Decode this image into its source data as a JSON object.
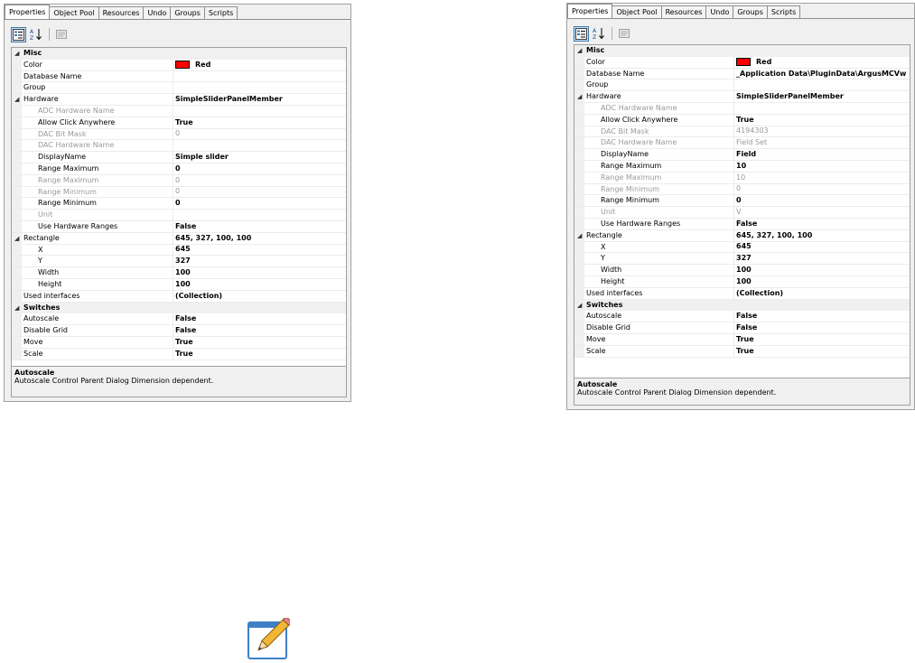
{
  "panels": [
    {
      "tabs": [
        "Properties",
        "Object Pool",
        "Resources",
        "Undo",
        "Groups",
        "Scripts"
      ],
      "rows": [
        {
          "type": "cat",
          "name": "Misc"
        },
        {
          "type": "prop",
          "name": "Color",
          "value": "Red",
          "swatch": true
        },
        {
          "type": "prop",
          "name": "Database Name",
          "value": ""
        },
        {
          "type": "prop",
          "name": "Group",
          "value": ""
        },
        {
          "type": "group",
          "name": "Hardware",
          "value": "SimpleSliderPanelMember",
          "style": "bold"
        },
        {
          "type": "sub",
          "name": "ADC Hardware Name",
          "value": "",
          "style": "gray"
        },
        {
          "type": "sub",
          "name": "Allow Click Anywhere",
          "value": "True",
          "style": "bold"
        },
        {
          "type": "sub",
          "name": "DAC Bit Mask",
          "value": "0",
          "style": "gray"
        },
        {
          "type": "sub",
          "name": "DAC Hardware Name",
          "value": "",
          "style": "gray"
        },
        {
          "type": "sub",
          "name": "DisplayName",
          "value": "Simple slider",
          "style": "bold"
        },
        {
          "type": "sub",
          "name": "Range Maximum",
          "value": "0",
          "style": "bold"
        },
        {
          "type": "sub",
          "name": "Range Maximum",
          "value": "0",
          "style": "gray"
        },
        {
          "type": "sub",
          "name": "Range Minimum",
          "value": "0",
          "style": "gray"
        },
        {
          "type": "sub",
          "name": "Range Minimum",
          "value": "0",
          "style": "bold"
        },
        {
          "type": "sub",
          "name": "Unit",
          "value": "",
          "style": "gray"
        },
        {
          "type": "sub",
          "name": "Use Hardware Ranges",
          "value": "False",
          "style": "bold"
        },
        {
          "type": "group",
          "name": "Rectangle",
          "value": "645, 327, 100, 100",
          "style": "bold"
        },
        {
          "type": "sub",
          "name": "X",
          "value": "645",
          "style": "bold"
        },
        {
          "type": "sub",
          "name": "Y",
          "value": "327",
          "style": "bold"
        },
        {
          "type": "sub",
          "name": "Width",
          "value": "100",
          "style": "bold"
        },
        {
          "type": "sub",
          "name": "Height",
          "value": "100",
          "style": "bold"
        },
        {
          "type": "prop",
          "name": "Used interfaces",
          "value": "(Collection)",
          "style": "bold"
        },
        {
          "type": "cat",
          "name": "Switches"
        },
        {
          "type": "prop",
          "name": "Autoscale",
          "value": "False",
          "style": "bold"
        },
        {
          "type": "prop",
          "name": "Disable Grid",
          "value": "False",
          "style": "bold"
        },
        {
          "type": "prop",
          "name": "Move",
          "value": "True",
          "style": "bold"
        },
        {
          "type": "prop",
          "name": "Scale",
          "value": "True",
          "style": "bold"
        }
      ],
      "help_title": "Autoscale",
      "help_text": "Autoscale Control Parent Dialog Dimension dependent."
    },
    {
      "tabs": [
        "Properties",
        "Object Pool",
        "Resources",
        "Undo",
        "Groups",
        "Scripts"
      ],
      "rows": [
        {
          "type": "cat",
          "name": "Misc"
        },
        {
          "type": "prop",
          "name": "Color",
          "value": "Red",
          "swatch": true
        },
        {
          "type": "prop",
          "name": "Database Name",
          "value": "_Application Data\\PluginData\\ArgusMCVw",
          "style": "bold"
        },
        {
          "type": "prop",
          "name": "Group",
          "value": ""
        },
        {
          "type": "group",
          "name": "Hardware",
          "value": "SimpleSliderPanelMember",
          "style": "bold"
        },
        {
          "type": "sub",
          "name": "ADC Hardware Name",
          "value": "",
          "style": "gray"
        },
        {
          "type": "sub",
          "name": "Allow Click Anywhere",
          "value": "True",
          "style": "bold"
        },
        {
          "type": "sub",
          "name": "DAC Bit Mask",
          "value": "4194303",
          "style": "gray"
        },
        {
          "type": "sub",
          "name": "DAC Hardware Name",
          "value": "Field Set",
          "style": "gray"
        },
        {
          "type": "sub",
          "name": "DisplayName",
          "value": "Field",
          "style": "bold"
        },
        {
          "type": "sub",
          "name": "Range Maximum",
          "value": "10",
          "style": "bold"
        },
        {
          "type": "sub",
          "name": "Range Maximum",
          "value": "10",
          "style": "gray"
        },
        {
          "type": "sub",
          "name": "Range Minimum",
          "value": "0",
          "style": "gray"
        },
        {
          "type": "sub",
          "name": "Range Minimum",
          "value": "0",
          "style": "bold"
        },
        {
          "type": "sub",
          "name": "Unit",
          "value": "V",
          "style": "gray"
        },
        {
          "type": "sub",
          "name": "Use Hardware Ranges",
          "value": "False",
          "style": "bold"
        },
        {
          "type": "group",
          "name": "Rectangle",
          "value": "645, 327, 100, 100",
          "style": "bold"
        },
        {
          "type": "sub",
          "name": "X",
          "value": "645",
          "style": "bold"
        },
        {
          "type": "sub",
          "name": "Y",
          "value": "327",
          "style": "bold"
        },
        {
          "type": "sub",
          "name": "Width",
          "value": "100",
          "style": "bold"
        },
        {
          "type": "sub",
          "name": "Height",
          "value": "100",
          "style": "bold"
        },
        {
          "type": "prop",
          "name": "Used interfaces",
          "value": "(Collection)",
          "style": "bold"
        },
        {
          "type": "cat",
          "name": "Switches"
        },
        {
          "type": "prop",
          "name": "Autoscale",
          "value": "False",
          "style": "bold"
        },
        {
          "type": "prop",
          "name": "Disable Grid",
          "value": "False",
          "style": "bold"
        },
        {
          "type": "prop",
          "name": "Move",
          "value": "True",
          "style": "bold"
        },
        {
          "type": "prop",
          "name": "Scale",
          "value": "True",
          "style": "bold"
        }
      ],
      "help_title": "Autoscale",
      "help_text": "Autoscale Control Parent Dialog Dimension dependent."
    }
  ],
  "icons": {
    "categorized": "categorized-view-icon",
    "alphabetical": "alphabetical-sort-icon",
    "property_pages": "property-pages-icon",
    "pencil": "pencil-edit-icon"
  },
  "colors": {
    "swatch": "#ff0000",
    "accent": "#3d7bad"
  }
}
